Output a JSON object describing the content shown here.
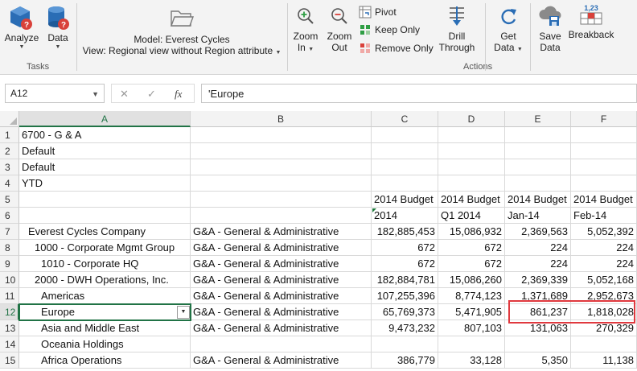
{
  "ribbon": {
    "analyze": "Analyze",
    "data": "Data",
    "tasks_label": "Tasks",
    "model_line": "Model: Everest Cycles",
    "view_line": "View: Regional view without Region attribute",
    "zoom_in_1": "Zoom",
    "zoom_in_2": "In",
    "zoom_out_1": "Zoom",
    "zoom_out_2": "Out",
    "pivot": "Pivot",
    "keep_only": "Keep Only",
    "remove_only": "Remove Only",
    "drill_1": "Drill",
    "drill_2": "Through",
    "get_data_1": "Get",
    "get_data_2": "Data",
    "save_data_1": "Save",
    "save_data_2": "Data",
    "breakback": "Breakback",
    "actions_label": "Actions"
  },
  "formula_bar": {
    "name_box": "A12",
    "cancel_icon": "✕",
    "enter_icon": "✓",
    "fx": "fx",
    "formula": "'Europe"
  },
  "columns": [
    "A",
    "B",
    "C",
    "D",
    "E",
    "F"
  ],
  "rows": [
    {
      "n": "1",
      "a": "6700 - G & A",
      "b": "",
      "c": "",
      "d": "",
      "e": "",
      "f": ""
    },
    {
      "n": "2",
      "a": "Default",
      "b": "",
      "c": "",
      "d": "",
      "e": "",
      "f": ""
    },
    {
      "n": "3",
      "a": "Default",
      "b": "",
      "c": "",
      "d": "",
      "e": "",
      "f": ""
    },
    {
      "n": "4",
      "a": "YTD",
      "b": "",
      "c": "",
      "d": "",
      "e": "",
      "f": ""
    },
    {
      "n": "5",
      "a": "",
      "b": "",
      "c": "2014 Budget",
      "d": "2014 Budget",
      "e": "2014 Budget",
      "f": "2014 Budget"
    },
    {
      "n": "6",
      "a": "",
      "b": "",
      "c": "2014",
      "d": "Q1 2014",
      "e": "Jan-14",
      "f": "Feb-14"
    },
    {
      "n": "7",
      "a": "  Everest Cycles Company",
      "b": "G&A - General & Administrative",
      "c": "182,885,453",
      "d": "15,086,932",
      "e": "2,369,563",
      "f": "5,052,392"
    },
    {
      "n": "8",
      "a": "    1000 - Corporate Mgmt Group",
      "b": "G&A - General & Administrative",
      "c": "672",
      "d": "672",
      "e": "224",
      "f": "224"
    },
    {
      "n": "9",
      "a": "      1010 - Corporate HQ",
      "b": "G&A - General & Administrative",
      "c": "672",
      "d": "672",
      "e": "224",
      "f": "224"
    },
    {
      "n": "10",
      "a": "    2000 - DWH Operations, Inc.",
      "b": "G&A - General & Administrative",
      "c": "182,884,781",
      "d": "15,086,260",
      "e": "2,369,339",
      "f": "5,052,168"
    },
    {
      "n": "11",
      "a": "      Americas",
      "b": "G&A - General & Administrative",
      "c": "107,255,396",
      "d": "8,774,123",
      "e": "1,371,689",
      "f": "2,952,673"
    },
    {
      "n": "12",
      "a": "      Europe",
      "b": "G&A - General & Administrative",
      "c": "65,769,373",
      "d": "5,471,905",
      "e": "861,237",
      "f": "1,818,028"
    },
    {
      "n": "13",
      "a": "      Asia and Middle East",
      "b": "G&A - General & Administrative",
      "c": "9,473,232",
      "d": "807,103",
      "e": "131,063",
      "f": "270,329"
    },
    {
      "n": "14",
      "a": "      Oceania Holdings",
      "b": "",
      "c": "",
      "d": "",
      "e": "",
      "f": ""
    },
    {
      "n": "15",
      "a": "      Africa Operations",
      "b": "G&A - General & Administrative",
      "c": "386,779",
      "d": "33,128",
      "e": "5,350",
      "f": "11,138"
    }
  ],
  "colors": {
    "accent": "#217346",
    "highlight": "#e0393e",
    "icon_blue": "#2a6db5",
    "icon_red": "#d9413a",
    "icon_green": "#2f9e44"
  }
}
